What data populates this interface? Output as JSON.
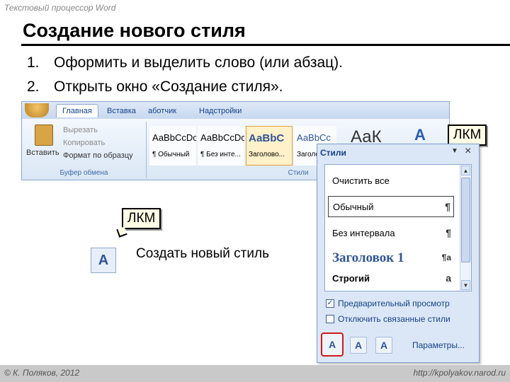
{
  "top_caption": "Текстовый процессор Word",
  "slide_title": "Создание нового стиля",
  "steps": [
    {
      "num": "1.",
      "text": "Оформить и выделить слово (или абзац)."
    },
    {
      "num": "2.",
      "text": "Открыть окно «Создание стиля»."
    }
  ],
  "ribbon": {
    "tabs": [
      "Главная",
      "Вставка",
      "аботчик",
      "Надстройки"
    ],
    "clipboard": {
      "paste": "Вставить",
      "cut": "Вырезать",
      "copy": "Копировать",
      "format_painter": "Формат по образцу",
      "group_label": "Буфер обмена"
    },
    "gallery": [
      {
        "sample": "АаBbCcDc",
        "name": "¶ Обычный"
      },
      {
        "sample": "АаBbCcDc",
        "name": "¶ Без инте..."
      },
      {
        "sample": "АаBbC",
        "name": "Заголово..."
      },
      {
        "sample": "АаBbCc",
        "name": "Заголо..."
      }
    ],
    "big_sample": "АаК",
    "styles_group_label": "Стили"
  },
  "styles_pane": {
    "title": "Стили",
    "items": [
      {
        "name": "Очистить все",
        "mark": ""
      },
      {
        "name": "Обычный",
        "mark": "¶"
      },
      {
        "name": "Без интервала",
        "mark": "¶"
      },
      {
        "name": "Заголовок 1",
        "mark": "¶a"
      },
      {
        "name": "Строгий",
        "mark": "a"
      }
    ],
    "options": [
      {
        "label": "Предварительный просмотр",
        "checked": true
      },
      {
        "label": "Отключить связанные стили",
        "checked": false
      }
    ],
    "params": "Параметры..."
  },
  "callouts": {
    "top": "ЛКМ",
    "left": "ЛКМ"
  },
  "create_style_label": "Создать новый стиль",
  "footer": {
    "left": "© К. Поляков, 2012",
    "right": "http://kpolyakov.narod.ru"
  }
}
